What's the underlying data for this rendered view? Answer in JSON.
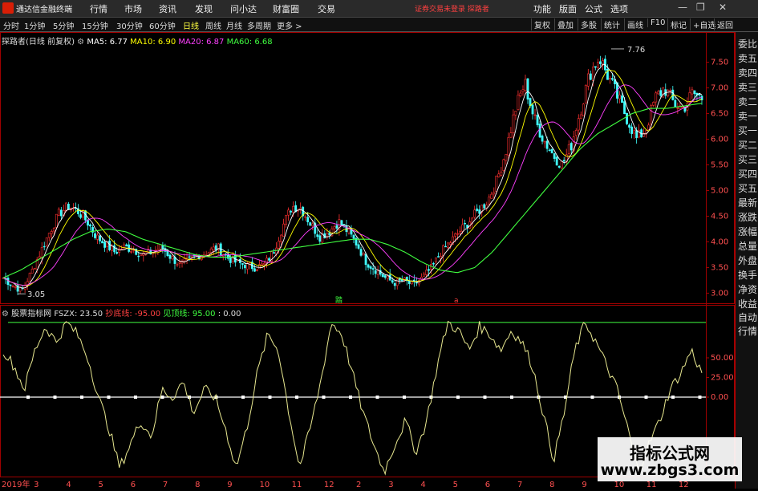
{
  "app": {
    "title": "通达信金融终端"
  },
  "menu": [
    "行情",
    "市场",
    "资讯",
    "发现",
    "问小达",
    "财富圈",
    "交易"
  ],
  "warning": "证券交易未登录  探路者",
  "top_right": [
    "功能",
    "版面",
    "公式",
    "选项"
  ],
  "toolbar": {
    "periods": [
      "分时",
      "1分钟",
      "5分钟",
      "15分钟",
      "30分钟",
      "60分钟",
      "日线",
      "周线",
      "月线",
      "多周期",
      "更多 >"
    ],
    "active": "日线",
    "right": [
      "复权",
      "叠加",
      "多股",
      "统计",
      "画线",
      "F10",
      "标记",
      "+自选",
      "返回"
    ]
  },
  "main_legend": {
    "name": "探路者(日线 前复权)",
    "ma5": "MA5: 6.77",
    "ma10": "MA10: 6.90",
    "ma20": "MA20: 6.87",
    "ma60": "MA60: 6.68"
  },
  "ind_legend": {
    "name": "股票指标网",
    "fszx": "FSZX: 23.50",
    "buy": "抄底线: -95.00",
    "sell": "见顶线: 95.00",
    "zero": ": 0.00"
  },
  "annotations": {
    "high": "7.76",
    "low": "3.05",
    "up_mark": "踏",
    "dn_mark": "a"
  },
  "right_panel": [
    "委比",
    "卖五",
    "卖四",
    "卖三",
    "卖二",
    "卖一",
    "买一",
    "买二",
    "买三",
    "买四",
    "买五",
    "最新",
    "涨跌",
    "涨幅",
    "总量",
    "外盘",
    "换手",
    "净资",
    "收益",
    "自动",
    "行情"
  ],
  "watermark": {
    "line1": "指标公式网",
    "line2": "www.zbgs3.com"
  },
  "colors": {
    "ma5": "#ffffff",
    "ma10": "#ffff00",
    "ma20": "#ff40ff",
    "ma60": "#40ff40",
    "up": "#ff3030",
    "down": "#40ffff",
    "indicator": "#e8e890"
  },
  "chart_data": [
    {
      "type": "candlestick",
      "title": "探路者(日线 前复权)",
      "ylim": [
        2.85,
        7.9
      ],
      "y_ticks": [
        "7.50",
        "7.00",
        "6.50",
        "6.00",
        "5.50",
        "5.00",
        "4.50",
        "4.00",
        "3.50",
        "3.00"
      ],
      "x_labels": [
        "2019年",
        "3",
        "4",
        "5",
        "6",
        "7",
        "8",
        "9",
        "10",
        "11",
        "12",
        "2",
        "3",
        "4",
        "5",
        "6",
        "7",
        "8",
        "9",
        "10",
        "11",
        "12"
      ],
      "close_path": [
        3.3,
        3.15,
        3.05,
        3.4,
        3.8,
        4.2,
        4.55,
        4.7,
        4.6,
        4.4,
        4.1,
        3.95,
        3.8,
        3.9,
        3.85,
        3.75,
        3.8,
        3.9,
        3.7,
        3.55,
        3.65,
        3.75,
        3.8,
        3.9,
        3.7,
        3.6,
        3.55,
        3.5,
        3.55,
        3.8,
        4.3,
        4.7,
        4.65,
        4.35,
        4.1,
        4.2,
        4.4,
        4.2,
        3.95,
        3.6,
        3.45,
        3.3,
        3.2,
        3.25,
        3.15,
        3.3,
        3.5,
        3.8,
        4.0,
        4.2,
        4.4,
        4.6,
        4.8,
        5.2,
        5.8,
        6.6,
        7.1,
        6.4,
        6.0,
        5.7,
        5.5,
        5.9,
        6.6,
        7.3,
        7.6,
        7.2,
        6.8,
        6.4,
        6.0,
        6.2,
        6.8,
        7.0,
        6.7,
        6.6,
        6.9,
        6.8
      ],
      "ma60_path": [
        3.3,
        3.45,
        3.65,
        3.85,
        4.05,
        4.2,
        4.25,
        4.2,
        4.05,
        3.95,
        3.85,
        3.75,
        3.7,
        3.7,
        3.75,
        3.8,
        3.85,
        3.9,
        3.95,
        4.0,
        4.05,
        4.05,
        3.95,
        3.8,
        3.6,
        3.45,
        3.4,
        3.5,
        3.8,
        4.2,
        4.6,
        5.0,
        5.4,
        5.8,
        6.1,
        6.3,
        6.5,
        6.6,
        6.6,
        6.65,
        6.7
      ]
    },
    {
      "type": "line",
      "series": [
        {
          "name": "FSZX"
        }
      ],
      "ylim": [
        -100,
        100
      ],
      "y_ticks": [
        "50.00",
        "25.00",
        "0.00"
      ],
      "values": [
        60,
        40,
        10,
        60,
        90,
        70,
        95,
        80,
        50,
        0,
        -40,
        -90,
        -60,
        -30,
        -50,
        10,
        0,
        20,
        -20,
        10,
        0,
        -40,
        -90,
        -40,
        30,
        80,
        60,
        -20,
        -90,
        -40,
        20,
        95,
        80,
        30,
        -20,
        -60,
        -95,
        -60,
        -30,
        -70,
        -30,
        40,
        95,
        85,
        60,
        90,
        80,
        60,
        85,
        70,
        40,
        -20,
        -80,
        -20,
        60,
        95,
        70,
        40,
        10,
        -40,
        -95,
        -60,
        -30,
        10,
        30,
        60,
        30
      ]
    }
  ]
}
